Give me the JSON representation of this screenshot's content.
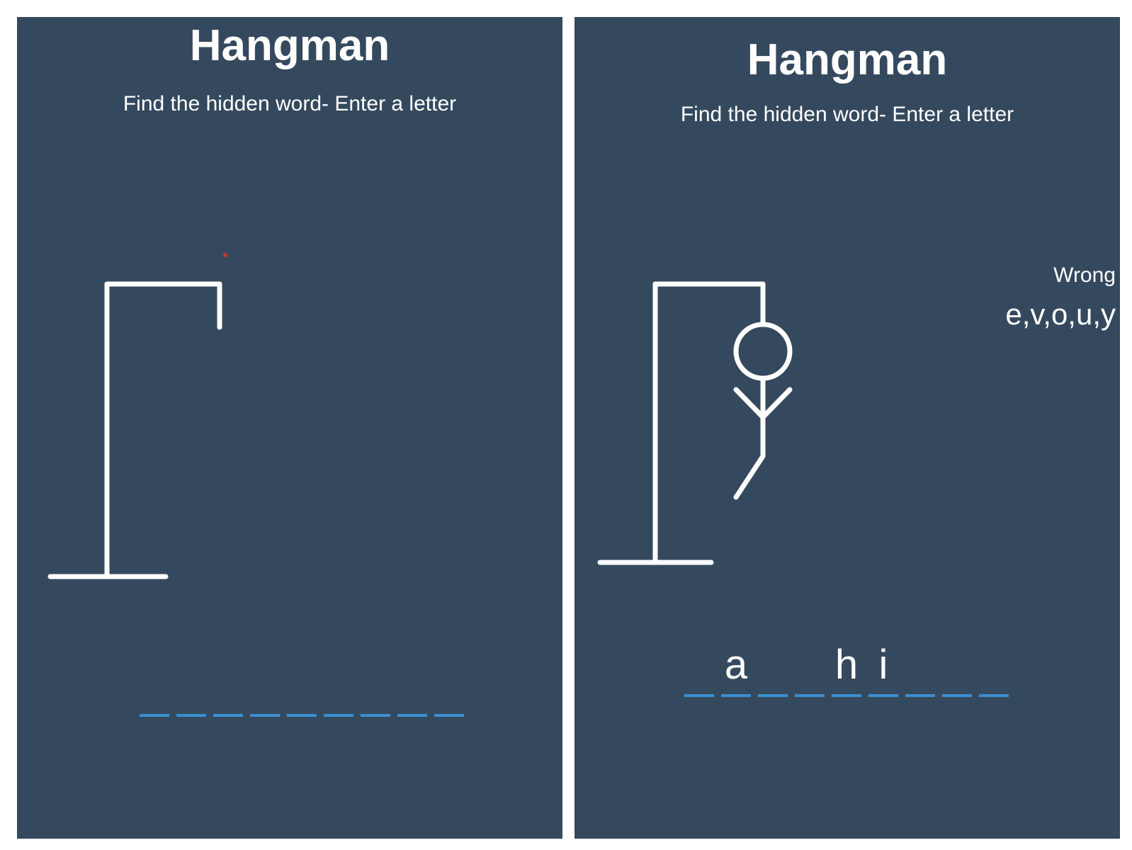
{
  "colors": {
    "background": "#35495e",
    "foreground": "#ffffff",
    "blank_dash": "#3a8fd1",
    "marker_dot": "#c0392b"
  },
  "panels": [
    {
      "title": "Hangman",
      "subtitle": "Find the hidden word- Enter a letter",
      "parts_drawn": [
        "base",
        "pole",
        "beam",
        "rope"
      ],
      "blanks": [
        "",
        "",
        "",
        "",
        "",
        "",
        "",
        "",
        ""
      ]
    },
    {
      "title": "Hangman",
      "subtitle": "Find the hidden word- Enter a letter",
      "parts_drawn": [
        "base",
        "pole",
        "beam",
        "rope",
        "head",
        "body",
        "left-arm",
        "right-arm",
        "left-leg"
      ],
      "wrong_label": "Wrong",
      "wrong_letters": "e,v,o,u,y",
      "blanks": [
        "",
        "a",
        "",
        "",
        "h",
        "i",
        "",
        "",
        ""
      ]
    }
  ]
}
